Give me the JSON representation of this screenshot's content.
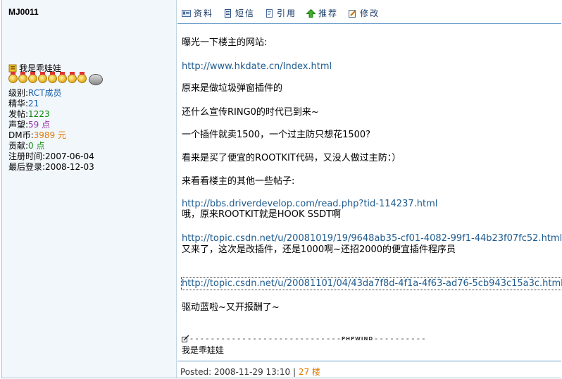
{
  "author": {
    "username": "MJ0011",
    "signature_name": "我是乖娃娃",
    "stats": [
      {
        "label": "级别:",
        "value": "RCT成员",
        "color": "blue"
      },
      {
        "label": "精华:",
        "value": "21",
        "color": "blue"
      },
      {
        "label": "发帖:",
        "value": "1223",
        "color": "green"
      },
      {
        "label": "声望:",
        "value": "59 点",
        "color": "purple"
      },
      {
        "label": "DM币:",
        "value": "3989 元",
        "color": "orange"
      },
      {
        "label": "贡献:",
        "value": "0 点",
        "color": "dgreen"
      },
      {
        "label": "注册时间:",
        "value": "2007-06-04",
        "color": "none"
      },
      {
        "label": "最后登录:",
        "value": "2008-12-03",
        "color": "none"
      }
    ]
  },
  "toolbar": {
    "profile": "资料",
    "message": "短信",
    "quote": "引用",
    "recommend": "推荐",
    "edit": "修改"
  },
  "post": {
    "l1": "曝光一下楼主的网站:",
    "l2": "http://www.hkdate.cn/Index.html",
    "l3": "原来是做垃圾弹窗插件的",
    "l4": "还什么宣传RING0的时代已到来~",
    "l5": "一个插件就卖1500，一个过主防只想花1500?",
    "l6": "看来是买了便宜的ROOTKIT代码，又没人做过主防：）",
    "l7": "来看看楼主的其他一些帖子:",
    "l8": "http://bbs.driverdevelop.com/read.php?tid-114237.html",
    "l9": "哦，原来ROOTKIT就是HOOK SSDT啊",
    "l10": "http://topic.csdn.net/u/20081019/19/9648ab35-cf01-4082-99f1-44b23f07fc52.html",
    "l11": "又来了，这次是改插件，还是1000啊~还招2000的便宜插件程序员",
    "l12": "http://topic.csdn.net/u/20081101/04/43da7f8d-4f1a-4f63-ad76-5cb943c15a3c.html",
    "l13": "驱动蓝啦~又开报酬了~"
  },
  "signature": {
    "brand": "PHPWIND",
    "text": "我是乖娃娃"
  },
  "footer": {
    "posted": "Posted: 2008-11-29 13:10",
    "separator": "|",
    "floor": "27 楼"
  }
}
